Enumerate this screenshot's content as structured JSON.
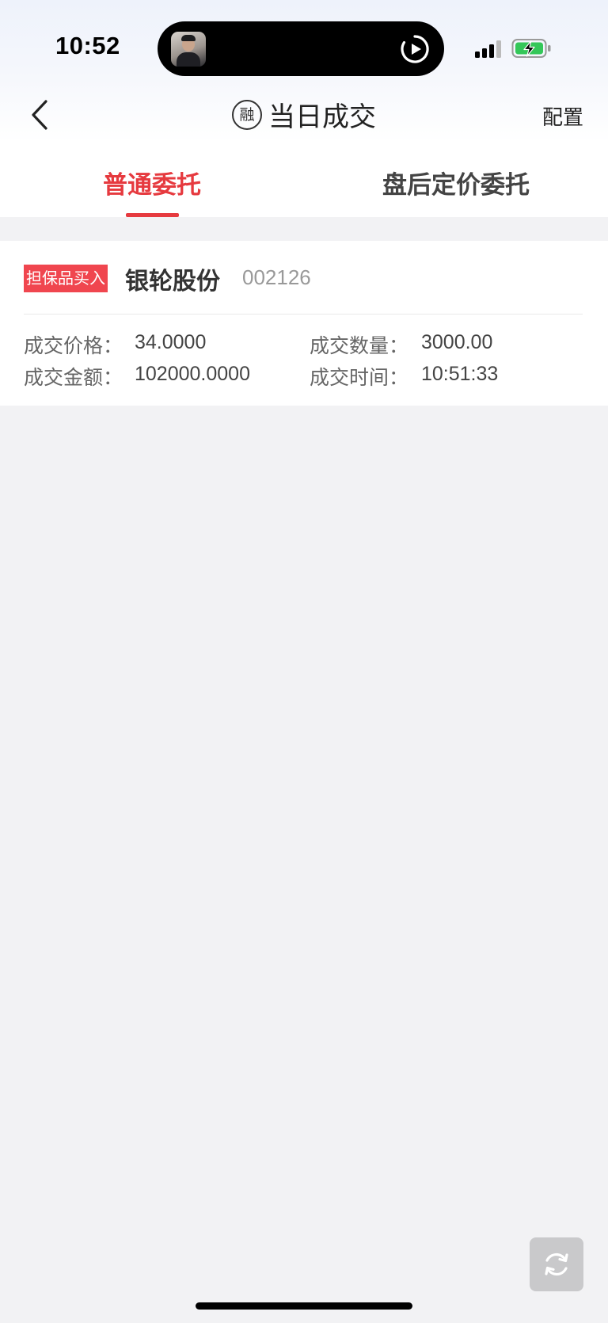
{
  "status_bar": {
    "time": "10:52"
  },
  "nav": {
    "title": "当日成交",
    "title_badge": "融",
    "config_label": "配置"
  },
  "tabs": [
    {
      "label": "普通委托",
      "active": true
    },
    {
      "label": "盘后定价委托",
      "active": false
    }
  ],
  "trade": {
    "tag": "担保品买入",
    "stock_name": "银轮股份",
    "stock_code": "002126",
    "fields": {
      "price_label": "成交价格：",
      "price_value": "34.0000",
      "quantity_label": "成交数量：",
      "quantity_value": "3000.00",
      "amount_label": "成交金额：",
      "amount_value": "102000.0000",
      "time_label": "成交时间：",
      "time_value": "10:51:33"
    }
  },
  "colors": {
    "accent": "#e63a3f",
    "tag_bg": "#f0464f",
    "page_bg": "#f2f2f4"
  },
  "icons": {
    "back": "chevron-left-icon",
    "refresh": "refresh-icon",
    "play": "play-circle-icon",
    "signal": "cellular-signal-icon",
    "battery": "battery-charging-icon"
  }
}
